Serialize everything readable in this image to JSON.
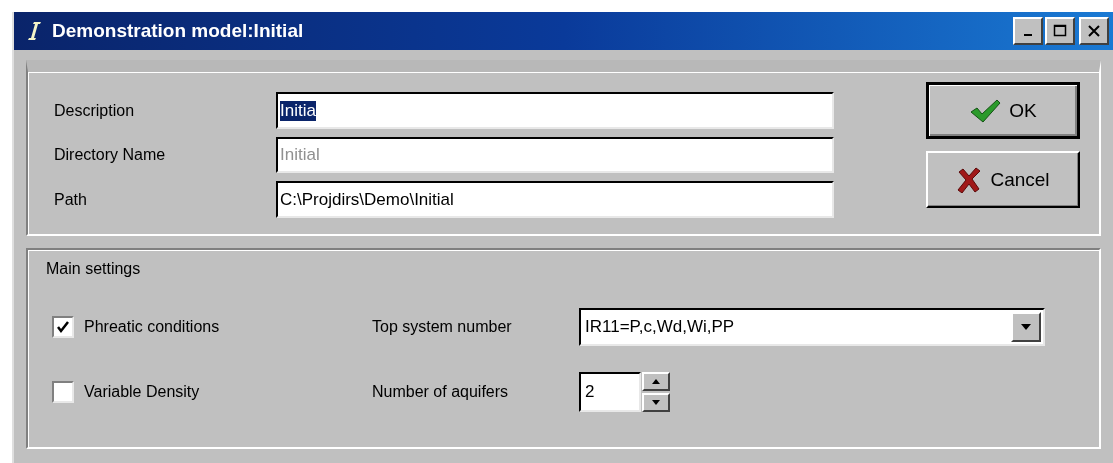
{
  "window": {
    "title": "Demonstration model:Initial"
  },
  "fields": [
    {
      "label": "Description",
      "value": "Initia",
      "text_selected": true,
      "disabled": false
    },
    {
      "label": "Directory Name",
      "value": "Initial",
      "text_selected": false,
      "disabled": true
    },
    {
      "label": "Path",
      "value": "C:\\Projdirs\\Demo\\Initial",
      "text_selected": false,
      "disabled": false
    }
  ],
  "buttons": [
    {
      "label": "OK",
      "kind": "ok"
    },
    {
      "label": "Cancel",
      "kind": "cancel"
    }
  ],
  "main_settings": {
    "title": "Main settings",
    "checkboxes": [
      {
        "label": "Phreatic conditions",
        "checked": true
      },
      {
        "label": "Variable Density",
        "checked": false
      }
    ],
    "top_system_number": {
      "label": "Top system number",
      "value": "IR11=P,c,Wd,Wi,PP"
    },
    "number_of_aquifers": {
      "label": "Number of aquifers",
      "value": "2"
    }
  }
}
